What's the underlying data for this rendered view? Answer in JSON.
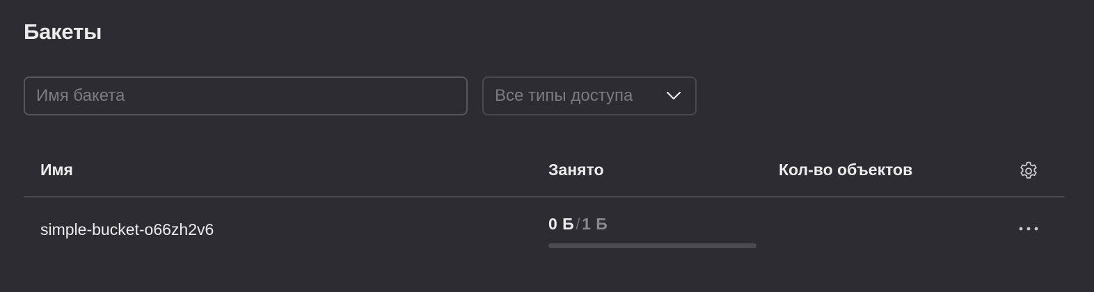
{
  "page": {
    "title": "Бакеты"
  },
  "filters": {
    "search_placeholder": "Имя бакета",
    "access_select_value": "Все типы доступа"
  },
  "table": {
    "columns": {
      "name": "Имя",
      "used": "Занято",
      "objects": "Кол-во объектов"
    },
    "rows": [
      {
        "name": "simple-bucket-o66zh2v6",
        "used": "0 Б",
        "separator": "/",
        "total": "1 Б",
        "usage_fraction": 0,
        "objects": ""
      }
    ]
  },
  "icons": {
    "settings": "gear-icon",
    "more": "ellipsis-icon",
    "select_arrow": "chevron-down-icon"
  },
  "colors": {
    "background": "#2d2c33",
    "text": "#ececec",
    "muted": "#7c7b82",
    "border": "#4a4950"
  }
}
